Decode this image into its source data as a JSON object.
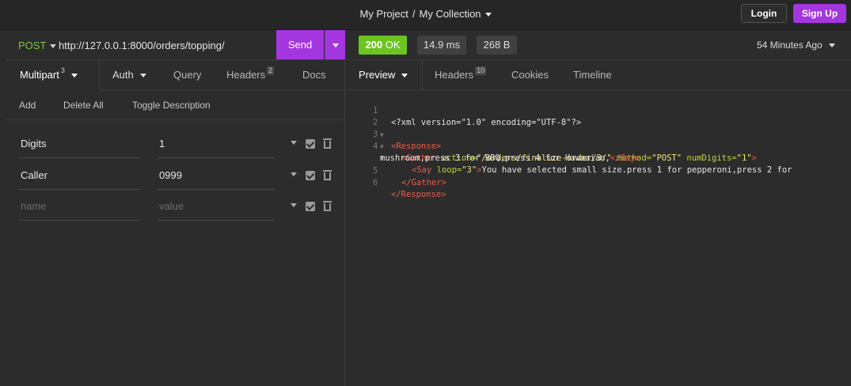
{
  "header": {
    "project": "My Project",
    "separator": "/",
    "collection": "My Collection",
    "login_label": "Login",
    "signup_label": "Sign Up"
  },
  "request": {
    "method": "POST",
    "url": "http://127.0.0.1:8000/orders/topping/",
    "send_label": "Send"
  },
  "left_tabs": {
    "multipart": "Multipart",
    "multipart_count": "3",
    "auth": "Auth",
    "query": "Query",
    "headers": "Headers",
    "headers_count": "2",
    "docs": "Docs"
  },
  "toolbar": {
    "add": "Add",
    "delete_all": "Delete All",
    "toggle_description": "Toggle Description"
  },
  "params": [
    {
      "name": "Digits",
      "value": "1"
    },
    {
      "name": "Caller",
      "value": "0999"
    }
  ],
  "new_param": {
    "name_placeholder": "name",
    "value_placeholder": "value"
  },
  "response": {
    "status_code": "200",
    "status_text": "OK",
    "time": "14.9 ms",
    "size": "268 B",
    "age": "54 Minutes Ago",
    "status_color": "#6cc421"
  },
  "right_tabs": {
    "preview": "Preview",
    "headers": "Headers",
    "headers_count": "10",
    "cookies": "Cookies",
    "timeline": "Timeline"
  },
  "code": {
    "line_numbers": [
      "1",
      "2",
      "3",
      "4",
      "",
      "5",
      "6"
    ],
    "l1": "<?xml version=\"1.0\" encoding=\"UTF-8\"?>",
    "l2_tag": "<Response>",
    "l3_open": "<Gather",
    "l3_attr1": "action=",
    "l3_val1": "\"/orders/finalize-order/3/\"",
    "l3_attr2": "method=",
    "l3_val2": "\"POST\"",
    "l3_attr3": "numDigits=",
    "l3_val3": "\"1\"",
    "l3_close": ">",
    "l4_open": "<Say",
    "l4_attr": "loop=",
    "l4_val": "\"3\"",
    "l4_close": ">",
    "l4_text": "You have selected small size.press 1 for pepperoni,press 2 for",
    "l4b_text": "mushroom,press 3 for BBQ,press 4 for Hawaaian,",
    "l4b_tag": "</Say>",
    "l5_tag": "</Gather>",
    "l6_tag": "</Response>"
  },
  "accent_color": "#a436e0"
}
